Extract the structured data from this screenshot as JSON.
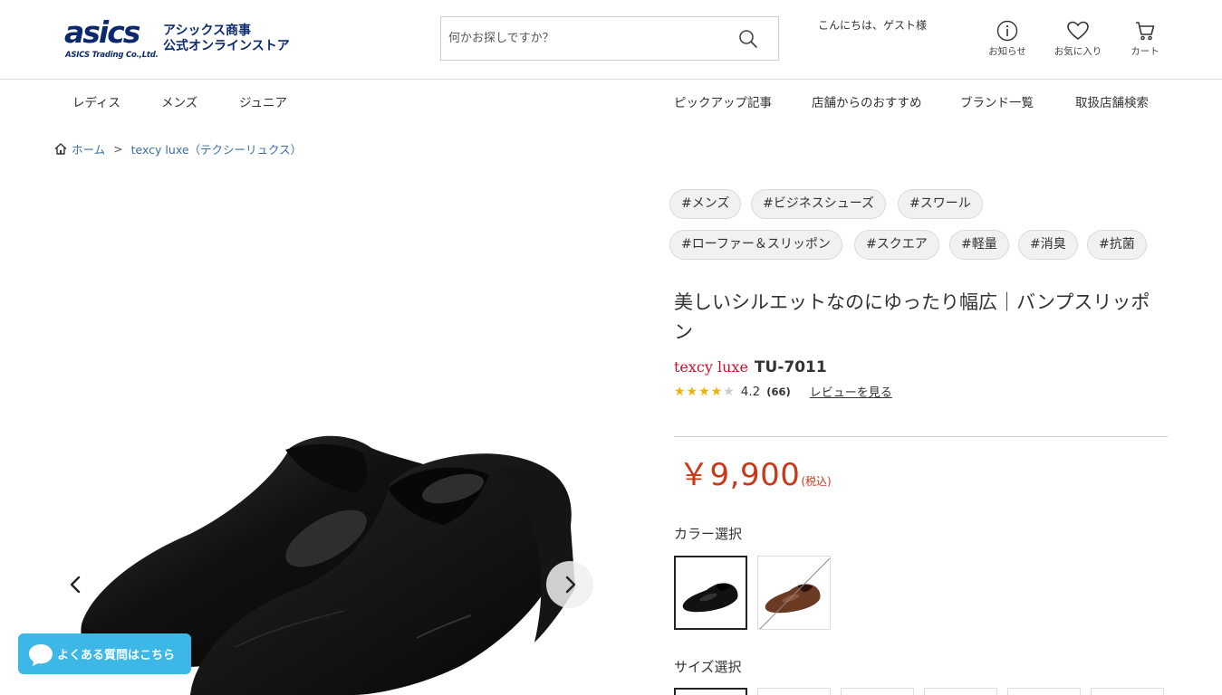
{
  "header": {
    "logo": {
      "mark": "asics",
      "sub": "ASICS Trading Co.,Ltd.",
      "jp_line1": "アシックス商事",
      "jp_line2": "公式オンラインストア"
    },
    "search": {
      "placeholder": "何かお探しですか？",
      "icon": "search-icon"
    },
    "greeting": "こんにちは、ゲスト様",
    "icons": [
      {
        "label": "お知らせ",
        "icon": "info-icon"
      },
      {
        "label": "お気に入り",
        "icon": "heart-icon"
      },
      {
        "label": "カート",
        "icon": "cart-icon"
      }
    ]
  },
  "nav": {
    "left": [
      "レディス",
      "メンズ",
      "ジュニア"
    ],
    "right": [
      "ピックアップ記事",
      "店舗からのおすすめ",
      "ブランド一覧",
      "取扱店舗検索"
    ]
  },
  "breadcrumb": {
    "home": "ホーム",
    "separator": ">",
    "current": "texcy luxe（テクシーリュクス）"
  },
  "product": {
    "tags": [
      "#メンズ",
      "#ビジネスシューズ",
      "#スワール",
      "#ローファー＆スリッポン",
      "#スクエア",
      "#軽量",
      "#消臭",
      "#抗菌"
    ],
    "title": "美しいシルエットなのにゆったり幅広｜バンプスリッポン",
    "brand": "texcy luxe",
    "model": "TU-7011",
    "rating": {
      "value": "4.2",
      "count": "(66)",
      "stars_filled": 4,
      "stars_total": 5,
      "review_link": "レビューを見る"
    },
    "price": {
      "main": "￥9,900",
      "tax": "(税込)"
    },
    "color_label": "カラー選択",
    "colors": [
      {
        "name": "black",
        "hex": "#111111",
        "selected": true
      },
      {
        "name": "brown",
        "hex": "#6b3a22",
        "selected": false,
        "sold_out": true
      }
    ],
    "size_label": "サイズ選択"
  },
  "faq_button": "よくある質問はこちら",
  "colors": {
    "price": "#c8391a",
    "brand": "#c8102e",
    "logo": "#0b2a6e",
    "faq": "#3db8e6",
    "link": "#3a6ea5",
    "star": "#f0b400"
  }
}
